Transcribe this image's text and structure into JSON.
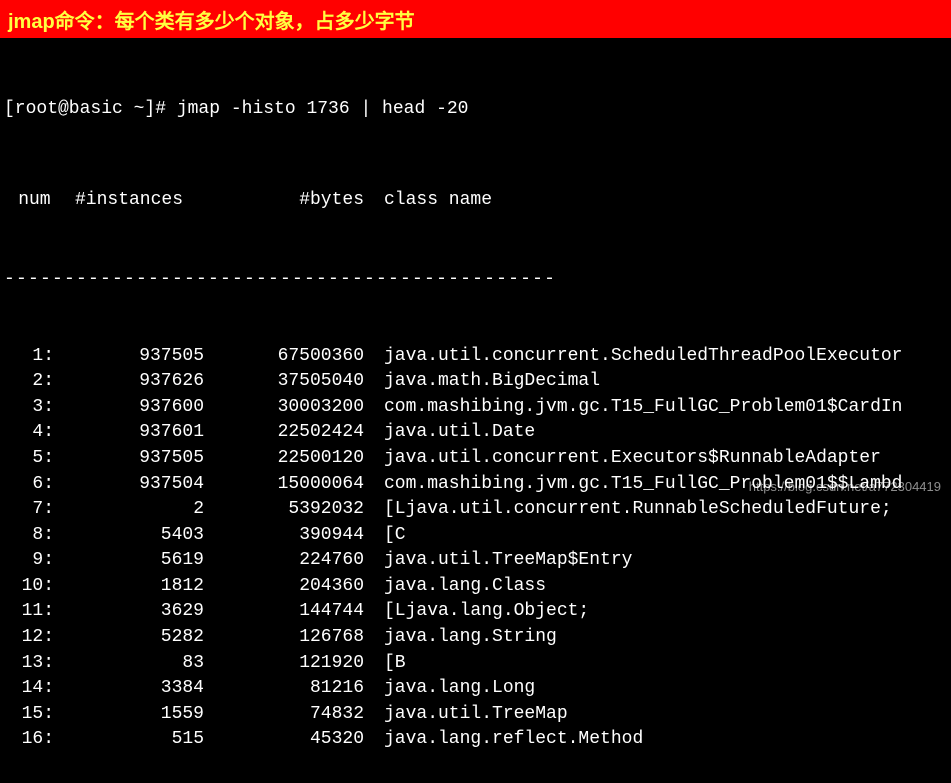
{
  "banner": {
    "text": "jmap命令：每个类有多少个对象，占多少字节"
  },
  "prompt": "[root@basic ~]# jmap -histo 1736 | head -20",
  "headers": {
    "num": " num",
    "instances": "#instances",
    "bytes": "#bytes",
    "classname": "class name"
  },
  "divider": "----------------------------------------------",
  "rows": [
    {
      "num": "1:",
      "instances": "937505",
      "bytes": "67500360",
      "classname": "java.util.concurrent.ScheduledThreadPoolExecutor"
    },
    {
      "num": "2:",
      "instances": "937626",
      "bytes": "37505040",
      "classname": "java.math.BigDecimal"
    },
    {
      "num": "3:",
      "instances": "937600",
      "bytes": "30003200",
      "classname": "com.mashibing.jvm.gc.T15_FullGC_Problem01$CardIn"
    },
    {
      "num": "4:",
      "instances": "937601",
      "bytes": "22502424",
      "classname": "java.util.Date"
    },
    {
      "num": "5:",
      "instances": "937505",
      "bytes": "22500120",
      "classname": "java.util.concurrent.Executors$RunnableAdapter"
    },
    {
      "num": "6:",
      "instances": "937504",
      "bytes": "15000064",
      "classname": "com.mashibing.jvm.gc.T15_FullGC_Problem01$$Lambd"
    },
    {
      "num": "7:",
      "instances": "2",
      "bytes": "5392032",
      "classname": "[Ljava.util.concurrent.RunnableScheduledFuture;"
    },
    {
      "num": "8:",
      "instances": "5403",
      "bytes": "390944",
      "classname": "[C"
    },
    {
      "num": "9:",
      "instances": "5619",
      "bytes": "224760",
      "classname": "java.util.TreeMap$Entry"
    },
    {
      "num": "10:",
      "instances": "1812",
      "bytes": "204360",
      "classname": "java.lang.Class"
    },
    {
      "num": "11:",
      "instances": "3629",
      "bytes": "144744",
      "classname": "[Ljava.lang.Object;"
    },
    {
      "num": "12:",
      "instances": "5282",
      "bytes": "126768",
      "classname": "java.lang.String"
    },
    {
      "num": "13:",
      "instances": "83",
      "bytes": "121920",
      "classname": "[B"
    },
    {
      "num": "14:",
      "instances": "3384",
      "bytes": "81216",
      "classname": "java.lang.Long"
    },
    {
      "num": "15:",
      "instances": "1559",
      "bytes": "74832",
      "classname": "java.util.TreeMap"
    },
    {
      "num": "16:",
      "instances": "515",
      "bytes": "45320",
      "classname": "java.lang.reflect.Method"
    }
  ],
  "watermark": "https://blog.csdn.net/a772304419"
}
